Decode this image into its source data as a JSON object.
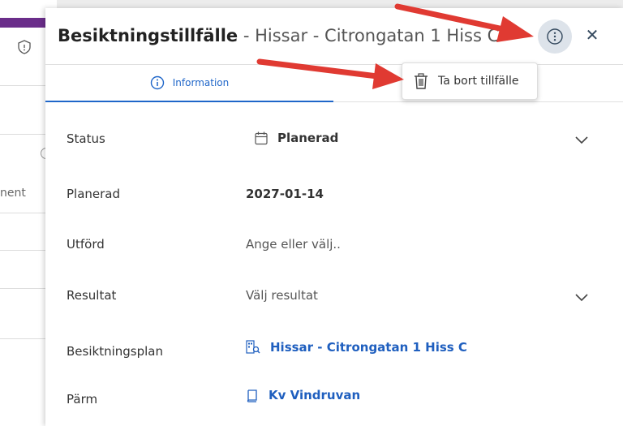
{
  "background": {
    "partial_text": "nent",
    "accent": "#6a2d8a"
  },
  "panel": {
    "title_bold": "Besiktningstillfälle",
    "title_rest": " - Hissar - Citrongatan 1 Hiss C",
    "more_icon": "more-vertical-circle-icon",
    "close_label": "✕"
  },
  "tabs": [
    {
      "label": "Information",
      "icon": "info-circle-icon",
      "active": true
    }
  ],
  "menu": {
    "items": [
      {
        "label": "Ta bort tillfälle",
        "icon": "trash-icon"
      }
    ]
  },
  "fields": {
    "status": {
      "label": "Status",
      "value": "Planerad"
    },
    "planerad": {
      "label": "Planerad",
      "value": "2027-01-14"
    },
    "utford": {
      "label": "Utförd",
      "placeholder": "Ange eller välj.."
    },
    "resultat": {
      "label": "Resultat",
      "placeholder": "Välj resultat"
    },
    "besiktningsplan": {
      "label": "Besiktningsplan",
      "value": "Hissar - Citrongatan 1 Hiss C"
    },
    "parm": {
      "label": "Pärm",
      "value": "Kv Vindruvan"
    }
  },
  "colors": {
    "link": "#1f5fbf",
    "active_tab": "#1f66c9",
    "arrow": "#e03a32"
  }
}
